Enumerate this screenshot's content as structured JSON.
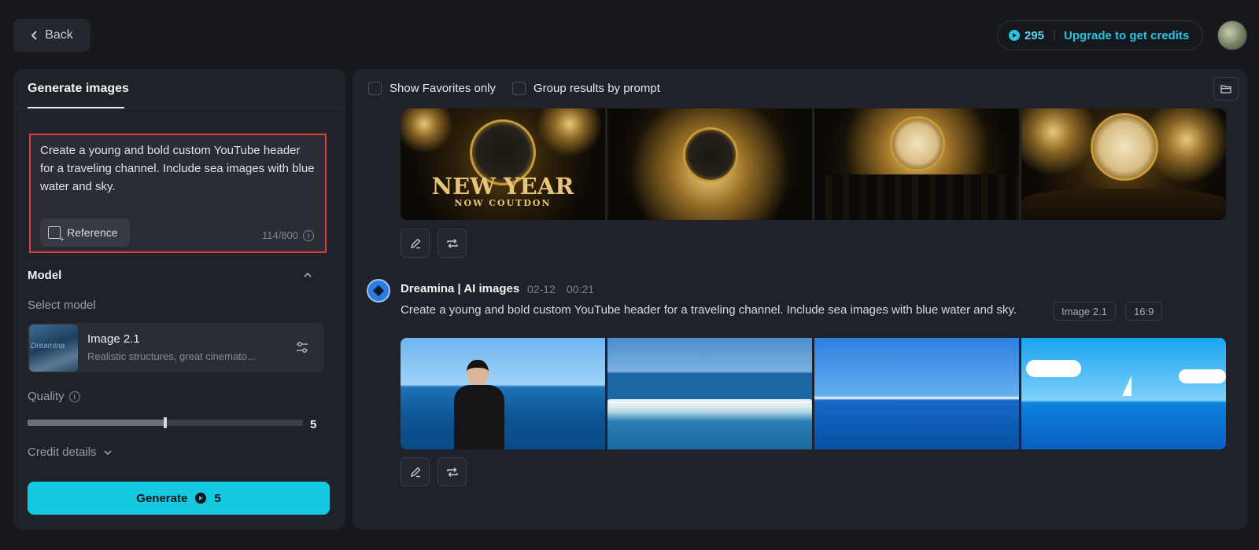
{
  "header": {
    "back_label": "Back",
    "credits_count": "295",
    "upgrade_label": "Upgrade to get credits"
  },
  "left_panel": {
    "tab_label": "Generate images",
    "prompt_text": "Create a young and bold custom YouTube header for a traveling channel. Include sea images with blue water and sky.",
    "reference_label": "Reference",
    "char_count": "114/800",
    "model_section_title": "Model",
    "select_model_label": "Select model",
    "model": {
      "name": "Image 2.1",
      "description": "Realistic structures, great cinemato...",
      "thumb_text": "Dreamina"
    },
    "quality_label": "Quality",
    "quality_value": "5",
    "quality_fraction": 0.5,
    "credit_details_label": "Credit details",
    "generate_label": "Generate",
    "generate_cost": "5"
  },
  "right_panel": {
    "filters": {
      "favorites_label": "Show Favorites only",
      "group_label": "Group results by prompt"
    },
    "first_result": {
      "images": [
        "new-year-countdown-clock",
        "golden-fireworks-clock",
        "city-fireworks-clock",
        "crowd-fireworks-clock"
      ],
      "new_year_text": "NEW YEAR",
      "countdown_text": "NOW COUTDON"
    },
    "second_result": {
      "author": "Dreamina | AI images",
      "date": "02-12",
      "time": "00:21",
      "prompt": "Create a young and bold custom YouTube header for a traveling channel. Include sea images with blue water and sky.",
      "model_tag": "Image 2.1",
      "ratio_tag": "16:9",
      "images": [
        "traveler-by-sea",
        "ocean-wave",
        "open-sea-horizon",
        "sailboat-sea"
      ]
    }
  },
  "colors": {
    "accent": "#14c9e0",
    "background": "#16181d",
    "panel": "#1f2228",
    "highlight_border": "#e23b3b"
  }
}
